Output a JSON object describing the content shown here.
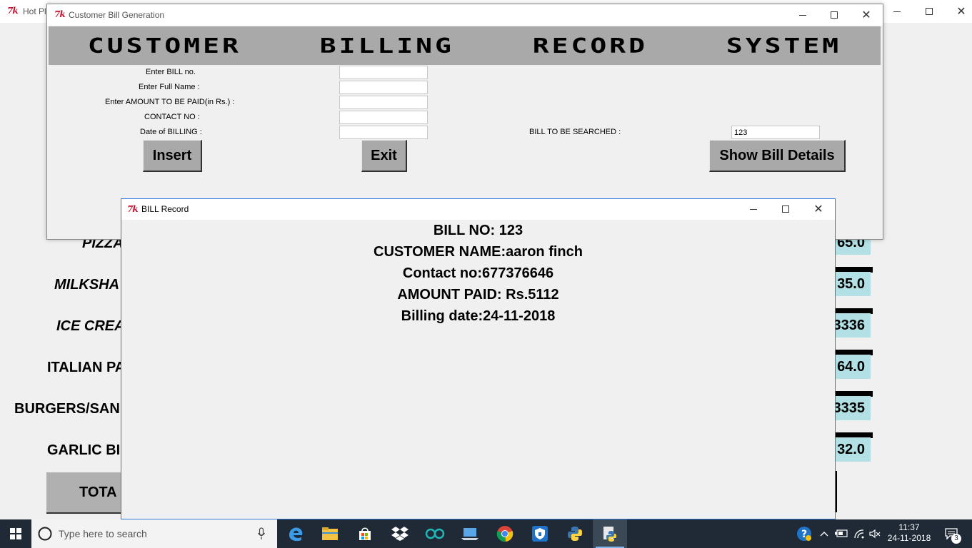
{
  "background_window": {
    "title": "Hot Pl",
    "items": [
      {
        "label": "PIZZA",
        "value": "65.0"
      },
      {
        "label": "MILKSHA",
        "value": "35.0"
      },
      {
        "label": "ICE CREA",
        "value": "3336"
      },
      {
        "label": "ITALIAN PA",
        "value": "64.0"
      },
      {
        "label": "BURGERS/SAN",
        "value": "3335"
      },
      {
        "label": "GARLIC BI",
        "value": "32.0"
      }
    ],
    "total_label": "TOTA"
  },
  "main_window": {
    "title": "Customer Bill Generation",
    "banner": [
      "CUSTOMER",
      "BILLING",
      "RECORD",
      "SYSTEM"
    ],
    "fields": [
      {
        "label": "Enter BILL no.",
        "value": ""
      },
      {
        "label": "Enter Full Name :",
        "value": ""
      },
      {
        "label": "Enter AMOUNT TO BE PAID(in Rs.) :",
        "value": ""
      },
      {
        "label": "CONTACT NO :",
        "value": ""
      },
      {
        "label": "Date of BILLING :",
        "value": ""
      }
    ],
    "search_label": "BILL TO BE SEARCHED :",
    "search_value": "123",
    "buttons": {
      "insert": "Insert",
      "exit": "Exit",
      "show": "Show Bill Details"
    }
  },
  "bill_window": {
    "title": "BILL Record",
    "lines": [
      "BILL NO: 123",
      "CUSTOMER NAME:aaron finch",
      "Contact no:677376646",
      "AMOUNT PAID: Rs.5112",
      "Billing date:24-11-2018"
    ]
  },
  "taskbar": {
    "search_placeholder": "Type here to search",
    "time": "11:37",
    "date": "24-11-2018",
    "notification_count": "3"
  },
  "icons": {
    "app": "tk-feather-icon",
    "taskbar": [
      "windows-start-icon",
      "microphone-icon",
      "edge-icon",
      "file-explorer-icon",
      "store-icon",
      "dropbox-icon",
      "arduino-icon",
      "laptop-icon",
      "chrome-icon",
      "vpn-shield-icon",
      "python-icon",
      "python-idle-icon"
    ]
  },
  "colors": {
    "banner_bg": "#a9a9a9",
    "button_bg": "#a9a9a9",
    "value_cell_bg": "#b2e0e4",
    "taskbar_bg": "#1f2a36",
    "tk_logo": "#c8102e"
  }
}
